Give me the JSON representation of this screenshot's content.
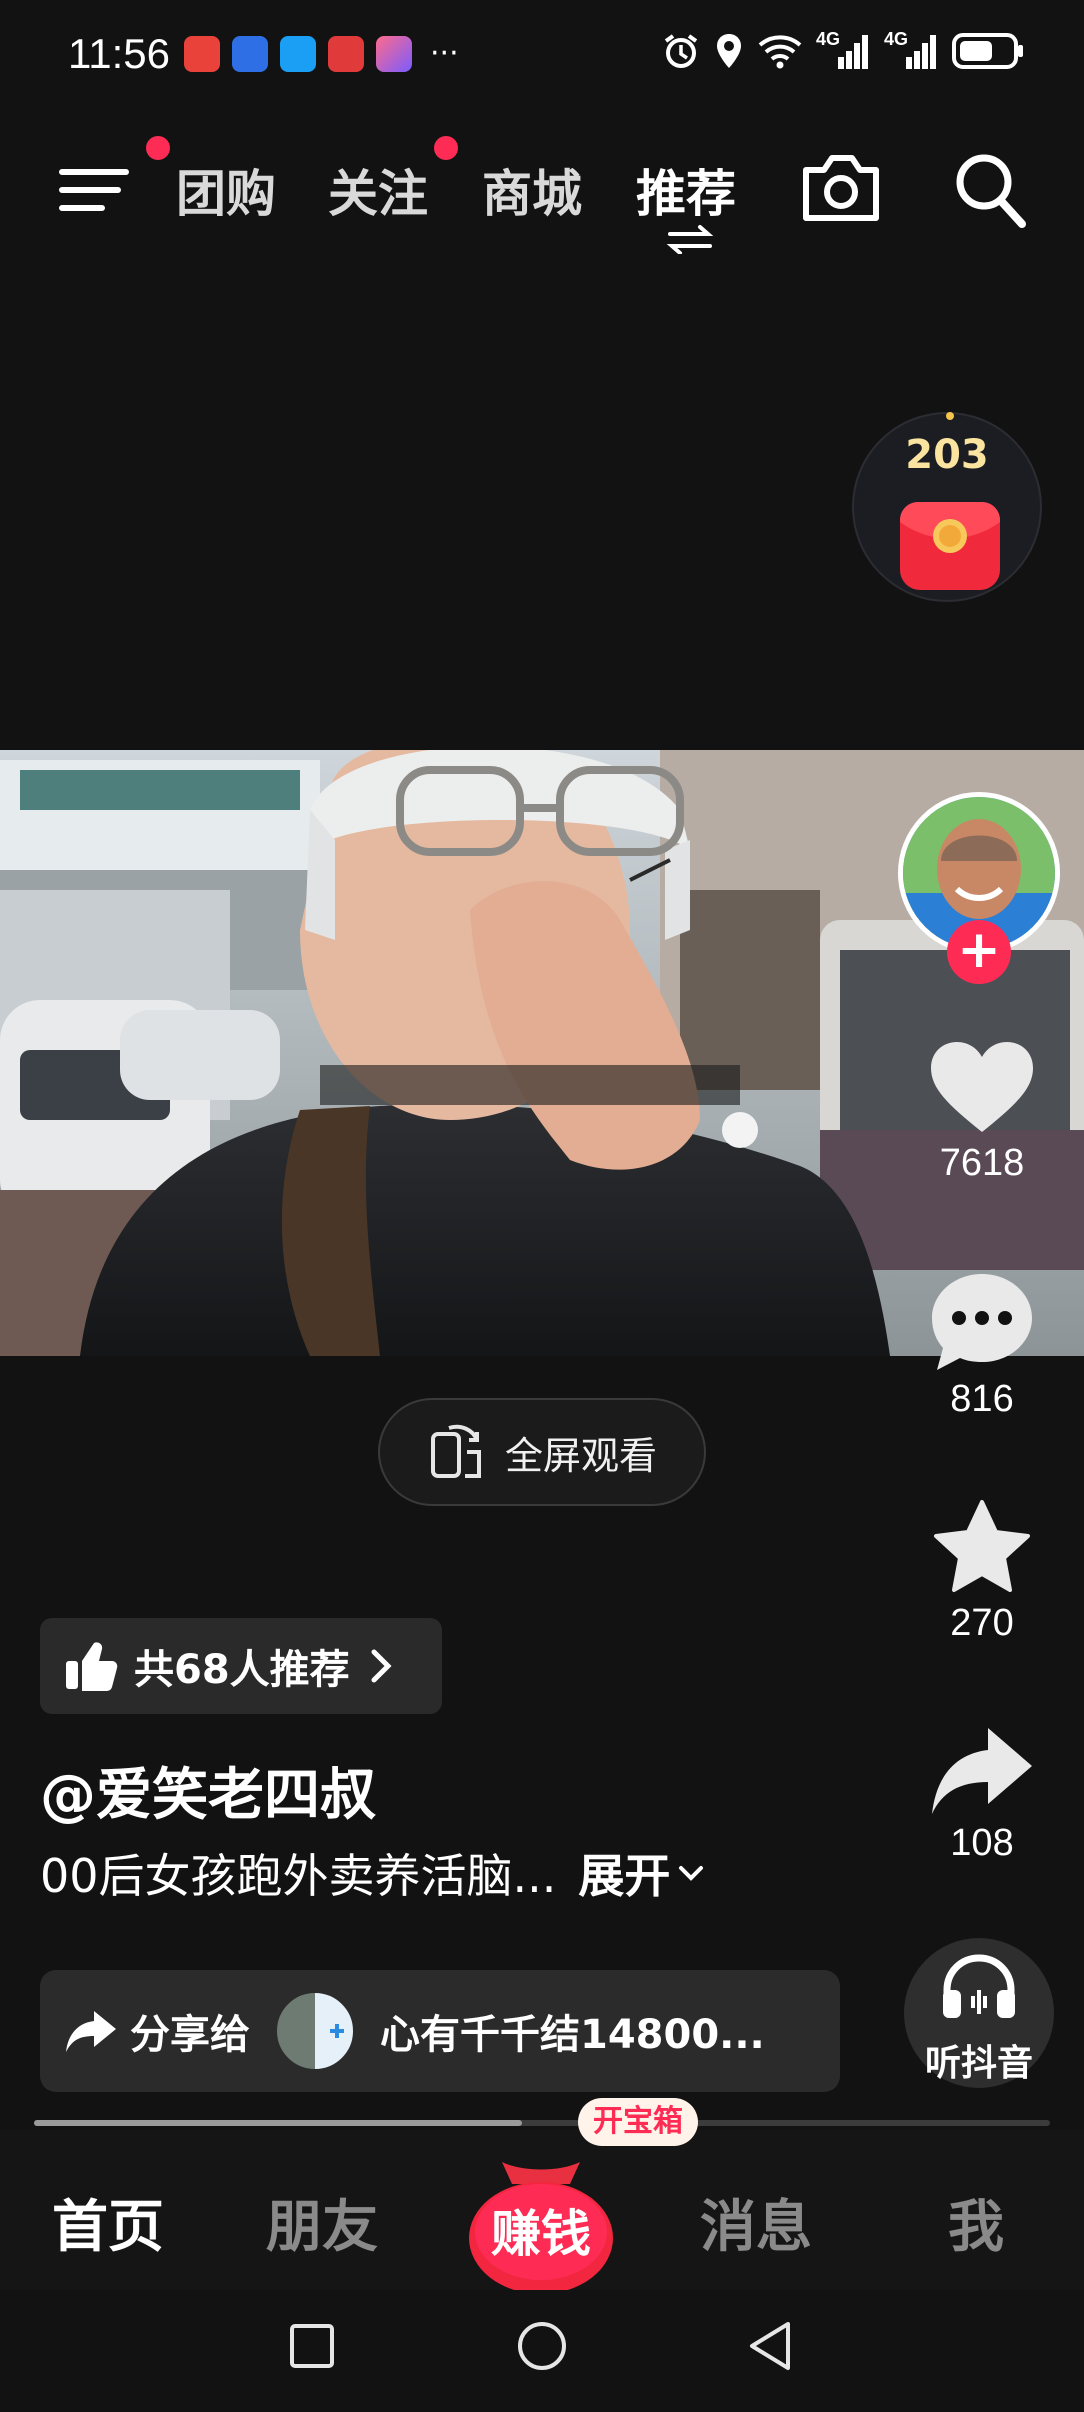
{
  "status_bar": {
    "time": "11:56",
    "more": "···",
    "network_1": "4G",
    "network_2": "4G"
  },
  "top_nav": {
    "tabs": [
      {
        "label": "团购",
        "badge": true
      },
      {
        "label": "关注",
        "badge": true
      },
      {
        "label": "商城",
        "badge": false
      },
      {
        "label": "推荐",
        "badge": false,
        "active": true
      }
    ]
  },
  "reward": {
    "count": "203"
  },
  "actions": {
    "likes": "7618",
    "comments": "816",
    "favorites": "270",
    "shares": "108"
  },
  "fullscreen": {
    "label": "全屏观看"
  },
  "recommend": {
    "label": "共68人推荐"
  },
  "post": {
    "author": "@爱笑老四叔",
    "caption": "00后女孩跑外卖养活脑...",
    "expand": "展开"
  },
  "share": {
    "label": "分享给",
    "target": "心有千千结14800..."
  },
  "listen": {
    "label": "听抖音"
  },
  "video": {
    "progress": 0.48
  },
  "bottom_nav": {
    "home": "首页",
    "friends": "朋友",
    "earn": "赚钱",
    "treasure": "开宝箱",
    "messages": "消息",
    "me": "我"
  },
  "colors": {
    "accent": "#fe2c55",
    "background": "#121212"
  }
}
